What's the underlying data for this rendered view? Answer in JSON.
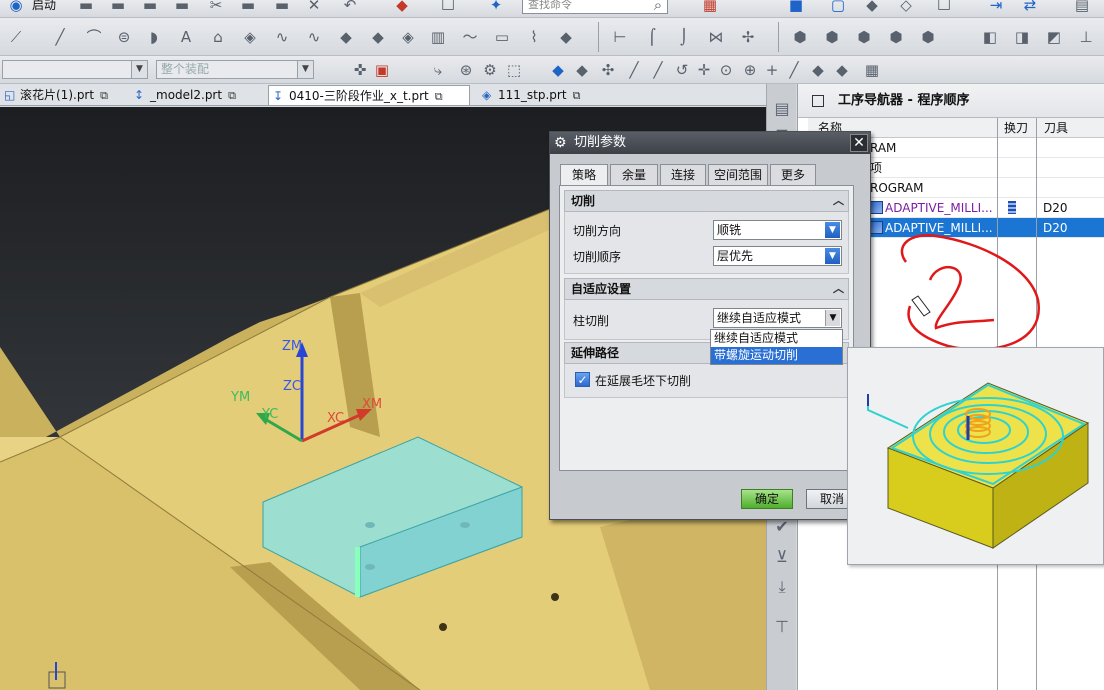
{
  "toolbar": {
    "start_label": "启动",
    "search_placeholder": "查找命令",
    "filter_combo": "",
    "assembly_combo": "整个装配"
  },
  "tabs": [
    {
      "label": "滚花片(1).prt",
      "active": false
    },
    {
      "label": "_model2.prt",
      "active": false
    },
    {
      "label": "0410-三阶段作业_x_t.prt",
      "active": true
    },
    {
      "label": "111_stp.prt",
      "active": false
    }
  ],
  "viewport": {
    "axes": {
      "zm": "ZM",
      "zc": "ZC",
      "ym": "YM",
      "yc": "YC",
      "xc": "XC",
      "xm": "XM"
    },
    "colors": {
      "model": "#e6cf7a",
      "pocket": "#7fd6d6",
      "background": "#1e2023"
    }
  },
  "navigator": {
    "title": "工序导航器 - 程序顺序",
    "columns": {
      "name": "名称",
      "tool_change": "换刀",
      "tool": "刀具"
    },
    "rows": [
      {
        "name": "RAM",
        "tool": "",
        "type": "root"
      },
      {
        "name": "项",
        "tool": "",
        "type": "root"
      },
      {
        "name": "ROGRAM",
        "tool": "",
        "type": "program"
      },
      {
        "name": "ADAPTIVE_MILLI...",
        "tool": "D20",
        "type": "operation",
        "tool_change": true,
        "selected": false
      },
      {
        "name": "ADAPTIVE_MILLI...",
        "tool": "D20",
        "type": "operation",
        "tool_change": false,
        "selected": true
      }
    ]
  },
  "dialog": {
    "title": "切削参数",
    "tabs": [
      "策略",
      "余量",
      "连接",
      "空间范围",
      "更多"
    ],
    "active_tab": "策略",
    "groups": {
      "cut": {
        "title": "切削",
        "fields": [
          {
            "label": "切削方向",
            "value": "顺铣"
          },
          {
            "label": "切削顺序",
            "value": "层优先"
          }
        ]
      },
      "adaptive": {
        "title": "自适应设置",
        "field_label": "柱切削",
        "field_value": "继续自适应模式",
        "options": [
          "继续自适应模式",
          "带螺旋运动切削"
        ],
        "highlighted_option": "带螺旋运动切削"
      },
      "extend": {
        "title": "延伸路径",
        "checkbox_label": "在延展毛坯下切削",
        "checked": true
      }
    },
    "ok_label": "确定",
    "cancel_label": "取消"
  },
  "preview": {
    "colors": {
      "block": "#e8e22a",
      "path": "#2fd2cf",
      "spiral": "#f0a21a"
    }
  }
}
